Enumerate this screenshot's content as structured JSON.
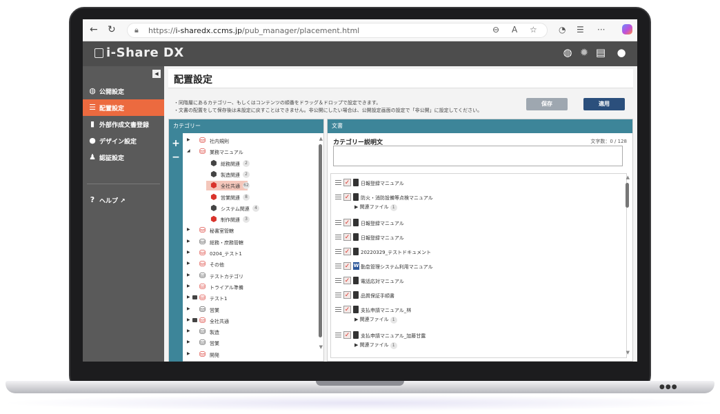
{
  "browser": {
    "url_prefix": "https://",
    "url_host": "i-sharedx.ccms.jp",
    "url_path": "/pub_manager/placement.html"
  },
  "app": {
    "logo": "i-Share DX"
  },
  "sidebar": {
    "items": [
      {
        "label": "公開設定",
        "icon": "globe-icon"
      },
      {
        "label": "配置設定",
        "icon": "menu-icon",
        "active": true
      },
      {
        "label": "外部作成文書登録",
        "icon": "file-icon"
      },
      {
        "label": "デザイン設定",
        "icon": "palette-icon"
      },
      {
        "label": "認証設定",
        "icon": "user-check-icon"
      },
      {
        "label": "ヘルプ",
        "icon": "help-icon"
      }
    ]
  },
  "page": {
    "title": "配置設定",
    "note1": "・同階層にあるカテゴリー、もしくはコンテンツの順番をドラッグ＆ドロップで設定できます。",
    "note2": "・文書の配置をして保存後は未設定に戻すことはできません。非公開にしたい場合は、公開設定画面の設定で「非公開」に設定してください。",
    "save_label": "保存",
    "apply_label": "適用"
  },
  "category_panel": {
    "header": "カテゴリー",
    "nodes": [
      {
        "name": "社内規則",
        "level": 0,
        "color": "red",
        "toggle": "collapsed"
      },
      {
        "name": "業務マニュアル",
        "level": 0,
        "color": "red",
        "toggle": "expanded"
      },
      {
        "name": "総務関連",
        "level": 1,
        "color": "dark",
        "count": "2"
      },
      {
        "name": "製造関連",
        "level": 1,
        "color": "dark",
        "count": "2"
      },
      {
        "name": "全社共通",
        "level": 1,
        "color": "red",
        "count": "62",
        "selected": true
      },
      {
        "name": "営業関連",
        "level": 1,
        "color": "red",
        "count": "8"
      },
      {
        "name": "システム関連",
        "level": 1,
        "color": "dark",
        "count": "4"
      },
      {
        "name": "制作関連",
        "level": 1,
        "color": "red",
        "count": "3"
      },
      {
        "name": "秘書室管轄",
        "level": 0,
        "color": "red",
        "toggle": "collapsed"
      },
      {
        "name": "総務・庶務管轄",
        "level": 0,
        "color": "dark",
        "toggle": "collapsed"
      },
      {
        "name": "0204_テスト1",
        "level": 0,
        "color": "red",
        "toggle": "collapsed"
      },
      {
        "name": "その他",
        "level": 0,
        "color": "red",
        "toggle": "collapsed"
      },
      {
        "name": "テストカテゴリ",
        "level": 0,
        "color": "dark",
        "toggle": "collapsed"
      },
      {
        "name": "トライアル準備",
        "level": 0,
        "color": "red",
        "toggle": "collapsed"
      },
      {
        "name": "テスト1",
        "level": 0,
        "color": "red",
        "toggle": "collapsed",
        "comment": true
      },
      {
        "name": "営業",
        "level": 0,
        "color": "dark",
        "toggle": "collapsed"
      },
      {
        "name": "全社共通",
        "level": 0,
        "color": "red",
        "toggle": "collapsed",
        "comment": true
      },
      {
        "name": "製造",
        "level": 0,
        "color": "dark",
        "toggle": "collapsed"
      },
      {
        "name": "営業",
        "level": 0,
        "color": "dark",
        "toggle": "collapsed"
      },
      {
        "name": "開発",
        "level": 0,
        "color": "red",
        "toggle": "collapsed"
      }
    ]
  },
  "doc_panel": {
    "header": "文書",
    "desc_label": "カテゴリー説明文",
    "char_count": "文字数：0 / 128",
    "related_label": "関連ファイル",
    "docs": [
      {
        "name": "日報登録マニュアル",
        "type": "book"
      },
      {
        "name": "防火・消防設備等点検マニュアル",
        "type": "book",
        "related": "1"
      },
      {
        "name": "日報登録マニュアル",
        "type": "book"
      },
      {
        "name": "日報登録マニュアル",
        "type": "book"
      },
      {
        "name": "20220329_テストドキュメント",
        "type": "book"
      },
      {
        "name": "勤怠管理システム利用マニュアル",
        "type": "word"
      },
      {
        "name": "電話応対マニュアル",
        "type": "book"
      },
      {
        "name": "品質保証手順書",
        "type": "book"
      },
      {
        "name": "支払申請マニュアル_林",
        "type": "book",
        "related": "1"
      },
      {
        "name": "支払申請マニュアル_加藤甘露",
        "type": "book",
        "related": "1"
      }
    ]
  },
  "colors": {
    "accent": "#ec6a3f",
    "panel_header": "#3d8599",
    "apply": "#2b4f7c",
    "sidebar": "#5a5a5a"
  }
}
